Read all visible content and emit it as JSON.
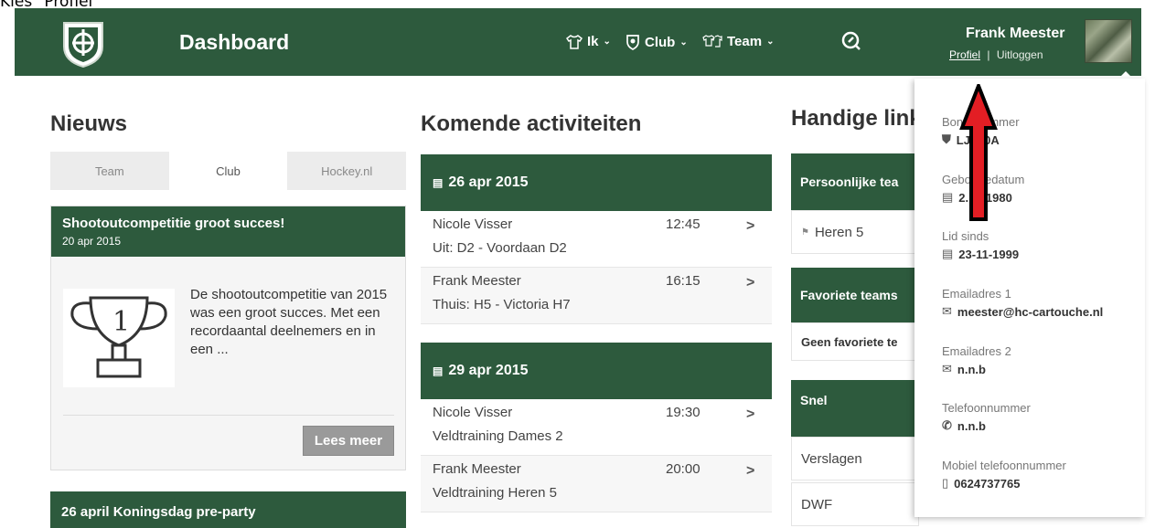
{
  "caption": "Kies \"Profiel\"",
  "nav": {
    "brand": "Dashboard",
    "items": [
      {
        "label": "Ik",
        "icon": "shirt-icon"
      },
      {
        "label": "Club",
        "icon": "shield-icon"
      },
      {
        "label": "Team",
        "icon": "team-shirts-icon"
      }
    ],
    "search_icon": "search-icon",
    "user_name": "Frank Meester",
    "profile_link": "Profiel",
    "separator": "|",
    "logout_link": "Uitloggen"
  },
  "news": {
    "title": "Nieuws",
    "tabs": [
      "Team",
      "Club",
      "Hockey.nl"
    ],
    "active_tab": "Club",
    "article": {
      "title": "Shootoutcompetitie groot succes!",
      "date": "20 apr 2015",
      "text": "De shootoutcompetitie van 2015 was een groot succes. Met een recordaantal deelnemers en in een ...",
      "button": "Lees meer"
    },
    "article2_title": "26 april Koningsdag pre-party"
  },
  "activities": {
    "title": "Komende activiteiten",
    "days": [
      {
        "date": "26 apr 2015",
        "items": [
          {
            "name": "Nicole Visser",
            "time": "12:45",
            "desc": "Uit: D2 - Voordaan D2"
          },
          {
            "name": "Frank Meester",
            "time": "16:15",
            "desc": "Thuis: H5 - Victoria H7"
          }
        ]
      },
      {
        "date": "29 apr 2015",
        "items": [
          {
            "name": "Nicole Visser",
            "time": "19:30",
            "desc": "Veldtraining Dames 2"
          },
          {
            "name": "Frank Meester",
            "time": "20:00",
            "desc": "Veldtraining Heren 5"
          }
        ]
      }
    ]
  },
  "links": {
    "title": "Handige link",
    "personal_teams_head": "Persoonlijke tea",
    "personal_team": "Heren 5",
    "favorite_head": "Favoriete teams",
    "favorite_empty": "Geen favoriete te",
    "snel_head": "Snel",
    "snel_items": [
      "Verslagen",
      "DWF"
    ]
  },
  "profile": {
    "items": [
      {
        "label": "Bondsnummer",
        "value": "LJ..L0A",
        "icon": "shield-icon"
      },
      {
        "label": "Geboortedatum",
        "value": "2...3-1980",
        "icon": "calendar-icon"
      },
      {
        "label": "Lid sinds",
        "value": "23-11-1999",
        "icon": "calendar-icon"
      },
      {
        "label": "Emailadres 1",
        "value": "meester@hc-cartouche.nl",
        "icon": "mail-icon"
      },
      {
        "label": "Emailadres 2",
        "value": "n.n.b",
        "icon": "mail-icon"
      },
      {
        "label": "Telefoonnummer",
        "value": "n.n.b",
        "icon": "phone-icon"
      },
      {
        "label": "Mobiel telefoonnummer",
        "value": "0624737765",
        "icon": "mobile-icon"
      }
    ]
  },
  "colors": {
    "brand_green": "#2d5a3d",
    "arrow_red": "#e31e24"
  }
}
